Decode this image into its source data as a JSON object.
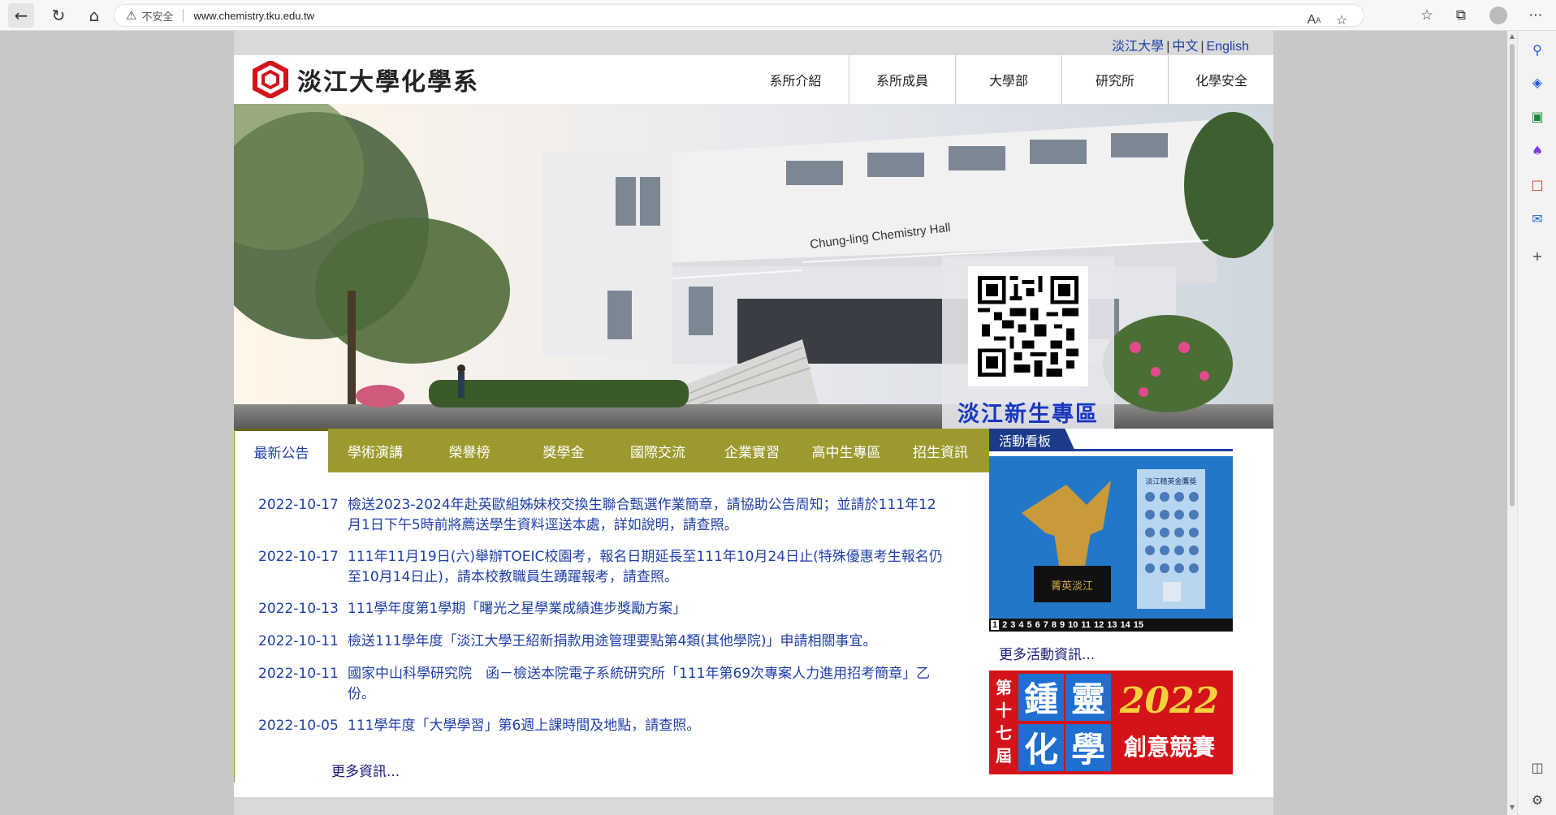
{
  "browser": {
    "insecure_label": "不安全",
    "url": "www.chemistry.tku.edu.tw"
  },
  "topbar": {
    "links": [
      "淡江大學",
      "中文",
      "English"
    ],
    "separator": "|"
  },
  "site": {
    "logo_text": "淡江大學化學系"
  },
  "mainnav": [
    "系所介紹",
    "系所成員",
    "大學部",
    "研究所",
    "化學安全"
  ],
  "hero": {
    "building_sign": "Chung-ling Chemistry Hall",
    "qr_caption": "淡江新生專區"
  },
  "tabs": [
    "最新公告",
    "學術演講",
    "榮譽榜",
    "獎學金",
    "國際交流",
    "企業實習",
    "高中生專區",
    "招生資訊"
  ],
  "news": [
    {
      "date": "2022-10-17",
      "title": "檢送2023-2024年赴英歐組姊妹校交換生聯合甄選作業簡章，請協助公告周知；並請於111年12月1日下午5時前將薦送學生資料逕送本處，詳如說明，請查照。"
    },
    {
      "date": "2022-10-17",
      "title": "111年11月19日(六)舉辦TOEIC校園考，報名日期延長至111年10月24日止(特殊優惠考生報名仍至10月14日止)，請本校教職員生踴躍報考，請查照。"
    },
    {
      "date": "2022-10-13",
      "title": "111學年度第1學期「曙光之星學業成績進步獎勵方案」"
    },
    {
      "date": "2022-10-11",
      "title": "檢送111學年度「淡江大學王紹新捐款用途管理要點第4類(其他學院)」申請相關事宜。"
    },
    {
      "date": "2022-10-11",
      "title": "國家中山科學研究院　函－檢送本院電子系統研究所「111年第69次專案人力進用招考簡章」乙份。"
    },
    {
      "date": "2022-10-05",
      "title": "111學年度「大學學習」第6週上課時間及地點，請查照。"
    }
  ],
  "news_more": "更多資訊...",
  "board": {
    "title": "活動看板",
    "poster_title": "淡江精英金鷹獎",
    "poster_base": "菁英淡江",
    "pages": [
      "1",
      "2",
      "3",
      "4",
      "5",
      "6",
      "7",
      "8",
      "9",
      "10",
      "11",
      "12",
      "13",
      "14",
      "15"
    ],
    "more": "更多活動資訊..."
  },
  "banner": {
    "edition": "第十七屆",
    "big_chars": [
      "鍾",
      "靈",
      "化",
      "學"
    ],
    "year": "2022",
    "subtitle": "創意競賽"
  },
  "colors": {
    "tab_bar": "#9c9a2e",
    "link": "#1f3fa8",
    "board_head": "#1b3a8a",
    "banner": "#d2141a"
  }
}
